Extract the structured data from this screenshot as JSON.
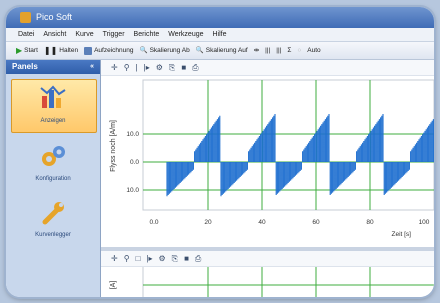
{
  "window": {
    "title": "Pico Soft"
  },
  "menu": [
    "Datei",
    "Ansicht",
    "Kurve",
    "Trigger",
    "Berichte",
    "Werkzeuge",
    "Hilfe"
  ],
  "toolbar": {
    "start": "Start",
    "stop": "Halten",
    "record": "Aufzeichnung",
    "zoom_x": "Skalierung Ab",
    "zoom_y": "Skalierung Auf",
    "auto": "Auto"
  },
  "sidebar": {
    "header": "Panels",
    "pin": "«",
    "items": [
      {
        "label": "Anzeigen",
        "icon": "chart-display-icon",
        "selected": true
      },
      {
        "label": "Konfiguration",
        "icon": "gears-icon",
        "selected": false
      },
      {
        "label": "Kurvenlegger",
        "icon": "wrench-icon",
        "selected": false
      }
    ]
  },
  "chart_top": {
    "ylabel": "Flyss noch [A/m]",
    "xlabel": "Zeit [s]",
    "y_ticks": [
      "10.0",
      "0.0",
      "10.0"
    ],
    "x_ticks": [
      "0.0",
      "20",
      "40",
      "60",
      "80",
      "100"
    ]
  },
  "chart_bottom": {
    "ylabel": "[A]"
  },
  "colors": {
    "signal": "#1f6fd0",
    "grid": "#3fae3f",
    "accent": "#ffc86a"
  }
}
